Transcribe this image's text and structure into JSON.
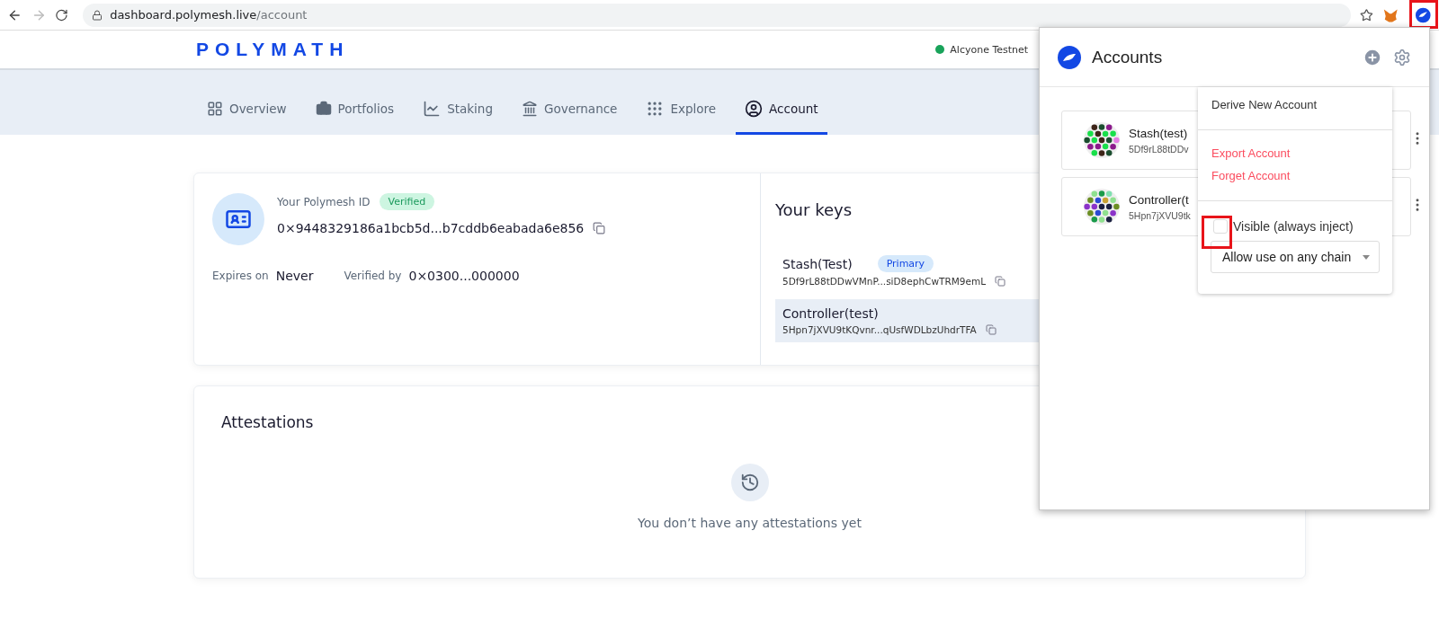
{
  "browser": {
    "url": {
      "host": "dashboard.polymesh.live",
      "path": "/account"
    },
    "forward_disabled": true
  },
  "header": {
    "logo": "POLYMATH",
    "network": "Alcyone Testnet"
  },
  "tabs": [
    {
      "label": "Overview",
      "selected": false
    },
    {
      "label": "Portfolios",
      "selected": false
    },
    {
      "label": "Staking",
      "selected": false
    },
    {
      "label": "Governance",
      "selected": false
    },
    {
      "label": "Explore",
      "selected": false
    },
    {
      "label": "Account",
      "selected": true
    }
  ],
  "identity": {
    "label": "Your Polymesh ID",
    "badge": "Verified",
    "did": "0×9448329186a1bcb5d...b7cddb6eabada6e856",
    "expires_label": "Expires on",
    "expires": "Never",
    "verified_by_label": "Verified by",
    "verified_by": "0×0300...000000"
  },
  "keys": {
    "title": "Your keys",
    "items": [
      {
        "name": "Stash(Test)",
        "badge": "Primary",
        "address": "5Df9rL88tDDwVMnP...siD8ephCwTRM9emL",
        "selected": false
      },
      {
        "name": "Controller(test)",
        "address": "5Hpn7jXVU9tKQvnr...qUsfWDLbzUhdrTFA",
        "selected": true
      }
    ]
  },
  "attestations": {
    "title": "Attestations",
    "empty": "You don’t have any attestations yet"
  },
  "popup": {
    "title": "Accounts",
    "accounts": [
      {
        "name": "Stash(test)",
        "address": "5Df9rL88tDDv"
      },
      {
        "name": "Controller(t",
        "address": "5Hpn7jXVU9tk"
      }
    ],
    "menu": {
      "items": [
        {
          "label": "Derive New Account",
          "kind": "normal"
        },
        {
          "label": "Export Account",
          "kind": "danger"
        },
        {
          "label": "Forget Account",
          "kind": "danger"
        }
      ],
      "visible": {
        "label": "Visible (always inject)",
        "checked": false
      },
      "chain": "Allow use on any chain"
    }
  }
}
